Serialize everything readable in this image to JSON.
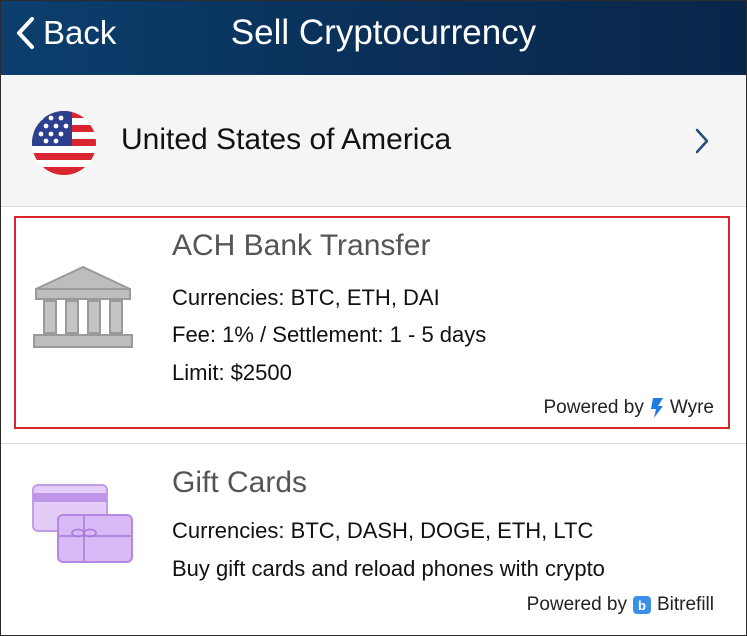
{
  "header": {
    "back_label": "Back",
    "title": "Sell Cryptocurrency",
    "background": "#0a2d55"
  },
  "country": {
    "name": "United States of America",
    "flag_icon": "usa-flag-icon",
    "chevron_icon": "chevron-right-icon"
  },
  "options": [
    {
      "title": "ACH Bank Transfer",
      "currencies": "Currencies: BTC, ETH, DAI",
      "fee": "Fee: 1% / Settlement: 1 - 5 days",
      "limit": "Limit: $2500",
      "powered_by": "Powered by",
      "provider": "Wyre",
      "icon": "bank-icon",
      "selected": true,
      "highlight_color": "#d9262c"
    },
    {
      "title": "Gift Cards",
      "currencies": "Currencies: BTC, DASH, DOGE, ETH, LTC",
      "description": "Buy gift cards and reload phones with crypto",
      "powered_by": "Powered by",
      "provider": "Bitrefill",
      "icon": "gift-card-icon",
      "accent_color": "#c9a6ef"
    }
  ]
}
